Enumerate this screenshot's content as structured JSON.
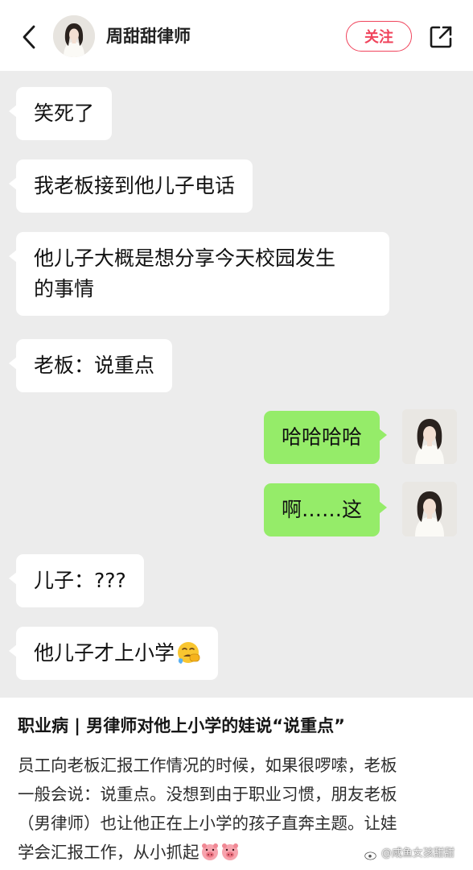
{
  "header": {
    "author_name": "周甜甜律师",
    "follow_label": "关注",
    "back_icon": "chevron-left-icon",
    "share_icon": "share-external-icon",
    "follow_color": "#f0445c"
  },
  "chat": {
    "background": "#ececec",
    "incoming_color": "#ffffff",
    "outgoing_color": "#95ec69",
    "messages": [
      {
        "side": "left",
        "text": "笑死了"
      },
      {
        "side": "left",
        "text": "我老板接到他儿子电话"
      },
      {
        "side": "left",
        "line1": "他儿子大概是想分享今天校园发生",
        "line2": "的事情"
      },
      {
        "side": "left",
        "text": "老板：说重点"
      },
      {
        "side": "right",
        "text": "哈哈哈哈"
      },
      {
        "side": "right",
        "text": "啊……这"
      },
      {
        "side": "left",
        "text": "儿子：???"
      },
      {
        "side": "left",
        "text": "他儿子才上小学",
        "emoji": "crying-face-emoji"
      }
    ]
  },
  "post": {
    "title": "职业病 | 男律师对他上小学的娃说“说重点”",
    "body_line1": "员工向老板汇报工作情况的时候，如果很啰嗦，老板",
    "body_line2": "一般会说：说重点。没想到由于职业习惯，朋友老板",
    "body_line3": "（男律师）也让他正在上小学的孩子直奔主题。让娃",
    "body_line4": "学会汇报工作，从小抓起",
    "body_emoji": "pig-face-emoji"
  },
  "watermark": {
    "text": "@咸鱼女孩甜甜",
    "icon": "weibo-logo-icon"
  }
}
